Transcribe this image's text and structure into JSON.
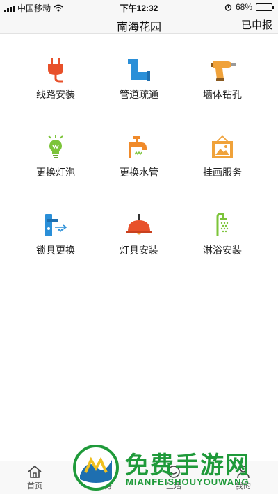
{
  "status": {
    "carrier": "中国移动",
    "time": "下午12:32",
    "battery": "68%",
    "battery_level": 0.68
  },
  "nav": {
    "title": "南海花园",
    "right_action": "已申报"
  },
  "services": [
    {
      "label": "线路安装",
      "icon": "plug-icon",
      "color": "#e8502a"
    },
    {
      "label": "管道疏通",
      "icon": "pipe-icon",
      "color": "#2a8fd8"
    },
    {
      "label": "墙体钻孔",
      "icon": "drill-icon",
      "color": "#f0a23a"
    },
    {
      "label": "更换灯泡",
      "icon": "bulb-icon",
      "color": "#7cc43a"
    },
    {
      "label": "更换水管",
      "icon": "faucet-icon",
      "color": "#f08a2a"
    },
    {
      "label": "挂画服务",
      "icon": "picture-icon",
      "color": "#f0a23a"
    },
    {
      "label": "锁具更换",
      "icon": "door-lock-icon",
      "color": "#2a8fd8"
    },
    {
      "label": "灯具安装",
      "icon": "ceiling-lamp-icon",
      "color": "#e8502a"
    },
    {
      "label": "淋浴安装",
      "icon": "shower-icon",
      "color": "#7cc43a"
    }
  ],
  "tabs": [
    {
      "label": "首页",
      "icon": "home-icon"
    },
    {
      "label": "服务",
      "icon": "service-icon"
    },
    {
      "label": "生活",
      "icon": "life-icon"
    },
    {
      "label": "我的",
      "icon": "user-icon"
    }
  ],
  "watermark": {
    "title": "免费手游网",
    "subtitle": "MIANFEISHOUYOUWANG"
  }
}
